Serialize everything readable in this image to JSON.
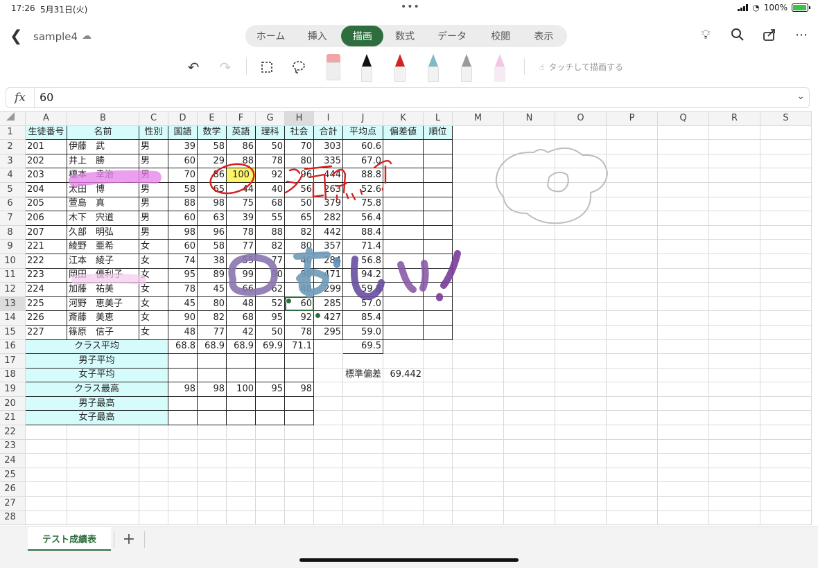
{
  "status": {
    "time": "17:26",
    "date": "5月31日(火)",
    "battery": "100%",
    "battery_level": 1.0
  },
  "file": {
    "name": "sample4"
  },
  "ribbon": {
    "tabs": [
      "ホーム",
      "挿入",
      "描画",
      "数式",
      "データ",
      "校閲",
      "表示"
    ],
    "active": "描画"
  },
  "toolbar": {
    "draw_touch_label": "タッチして描画する"
  },
  "formula": {
    "fx": "fx",
    "value": "60"
  },
  "columns": [
    "A",
    "B",
    "C",
    "D",
    "E",
    "F",
    "G",
    "H",
    "I",
    "J",
    "K",
    "L",
    "M",
    "N",
    "O",
    "P",
    "Q",
    "R",
    "S"
  ],
  "rows": [
    [
      "生徒番号",
      "名前",
      "性別",
      "国語",
      "数学",
      "英語",
      "理科",
      "社会",
      "合計",
      "平均点",
      "偏差値",
      "順位"
    ],
    [
      "201",
      "伊藤　武",
      "男",
      "39",
      "58",
      "86",
      "50",
      "70",
      "303",
      "60.6",
      "",
      ""
    ],
    [
      "202",
      "井上　勝",
      "男",
      "60",
      "29",
      "88",
      "78",
      "80",
      "335",
      "67.0",
      "",
      ""
    ],
    [
      "203",
      "榎本　幸治",
      "男",
      "70",
      "86",
      "100",
      "92",
      "96",
      "444",
      "88.8",
      "",
      ""
    ],
    [
      "204",
      "太田　博",
      "男",
      "58",
      "65",
      "44",
      "40",
      "56",
      "263",
      "52.6",
      "",
      ""
    ],
    [
      "205",
      "萱島　真",
      "男",
      "88",
      "98",
      "75",
      "68",
      "50",
      "379",
      "75.8",
      "",
      ""
    ],
    [
      "206",
      "木下　宍道",
      "男",
      "60",
      "63",
      "39",
      "55",
      "65",
      "282",
      "56.4",
      "",
      ""
    ],
    [
      "207",
      "久部　明弘",
      "男",
      "98",
      "96",
      "78",
      "88",
      "82",
      "442",
      "88.4",
      "",
      ""
    ],
    [
      "221",
      "綾野　亜希",
      "女",
      "60",
      "58",
      "77",
      "82",
      "80",
      "357",
      "71.4",
      "",
      ""
    ],
    [
      "222",
      "江本　綾子",
      "女",
      "74",
      "38",
      "55",
      "77",
      "40",
      "284",
      "56.8",
      "",
      ""
    ],
    [
      "223",
      "岡田　優利子",
      "女",
      "95",
      "89",
      "99",
      "90",
      "98",
      "471",
      "94.2",
      "",
      ""
    ],
    [
      "224",
      "加藤　祐美",
      "女",
      "78",
      "45",
      "66",
      "62",
      "48",
      "299",
      "59.8",
      "",
      ""
    ],
    [
      "225",
      "河野　恵美子",
      "女",
      "45",
      "80",
      "48",
      "52",
      "60",
      "285",
      "57.0",
      "",
      ""
    ],
    [
      "226",
      "斎藤　美恵",
      "女",
      "90",
      "82",
      "68",
      "95",
      "92",
      "427",
      "85.4",
      "",
      ""
    ],
    [
      "227",
      "篠原　信子",
      "女",
      "48",
      "77",
      "42",
      "50",
      "78",
      "295",
      "59.0",
      "",
      ""
    ]
  ],
  "summary": [
    {
      "label": "クラス平均",
      "values": [
        "68.8",
        "68.9",
        "68.9",
        "69.9",
        "71.1"
      ],
      "avg": "69.5"
    },
    {
      "label": "男子平均",
      "values": [
        "",
        "",
        "",
        "",
        ""
      ]
    },
    {
      "label": "女子平均",
      "values": [
        "",
        "",
        "",
        "",
        ""
      ]
    },
    {
      "label": "クラス最高",
      "values": [
        "98",
        "98",
        "100",
        "95",
        "98"
      ]
    },
    {
      "label": "男子最高",
      "values": [
        "",
        "",
        "",
        "",
        ""
      ]
    },
    {
      "label": "女子最高",
      "values": [
        "",
        "",
        "",
        "",
        ""
      ]
    }
  ],
  "stddev": {
    "label": "標準偏差",
    "value": "69.442"
  },
  "row_count": 28,
  "ink_text": {
    "manten": "満点！",
    "oishii": "おいしい！"
  },
  "sheet_tabs": {
    "active": "テスト成績表",
    "add": "+"
  },
  "colors": {
    "accent": "#2e6e3e",
    "header_fill": "#d6fbfb",
    "highlight_yellow": "#fff56a",
    "highlight_pink": "#e77fea"
  }
}
